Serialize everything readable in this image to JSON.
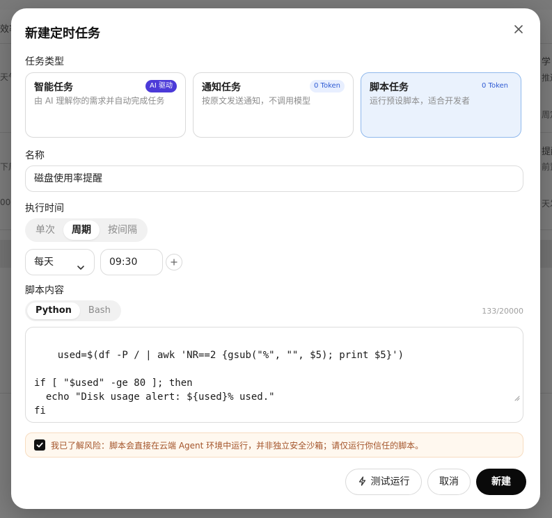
{
  "background": {
    "fragments": [
      "效率",
      "天气",
      "下周",
      "00",
      "学",
      "推送",
      "周定",
      "提醒",
      "前置",
      "天发"
    ]
  },
  "dialog": {
    "title": "新建定时任务",
    "task_type": {
      "label": "任务类型",
      "options": [
        {
          "name": "智能任务",
          "desc": "由 AI 理解你的需求并自动完成任务",
          "badge": "AI 驱动",
          "selected": false
        },
        {
          "name": "通知任务",
          "desc": "按原文发送通知，不调用模型",
          "badge": "0 Token",
          "selected": false
        },
        {
          "name": "脚本任务",
          "desc": "运行预设脚本，适合开发者",
          "badge": "0 Token",
          "selected": true
        }
      ]
    },
    "name_field": {
      "label": "名称",
      "value": "磁盘使用率提醒"
    },
    "schedule": {
      "label": "执行时间",
      "modes": [
        "单次",
        "周期",
        "按间隔"
      ],
      "active_mode": "周期",
      "frequency": "每天",
      "time": "09:30"
    },
    "script": {
      "label": "脚本内容",
      "languages": [
        "Python",
        "Bash"
      ],
      "active_language": "Python",
      "counter": "133/20000",
      "content": "used=$(df -P / | awk 'NR==2 {gsub(\"%\", \"\", $5); print $5}')\n\nif [ \"$used\" -ge 80 ]; then\n  echo \"Disk usage alert: ${used}% used.\"\nfi"
    },
    "risk_ack": {
      "checked": true,
      "text": "我已了解风险：脚本会直接在云端 Agent 环境中运行，并非独立安全沙箱；请仅运行你信任的脚本。"
    },
    "buttons": {
      "test_run": "测试运行",
      "cancel": "取消",
      "create": "新建"
    }
  }
}
